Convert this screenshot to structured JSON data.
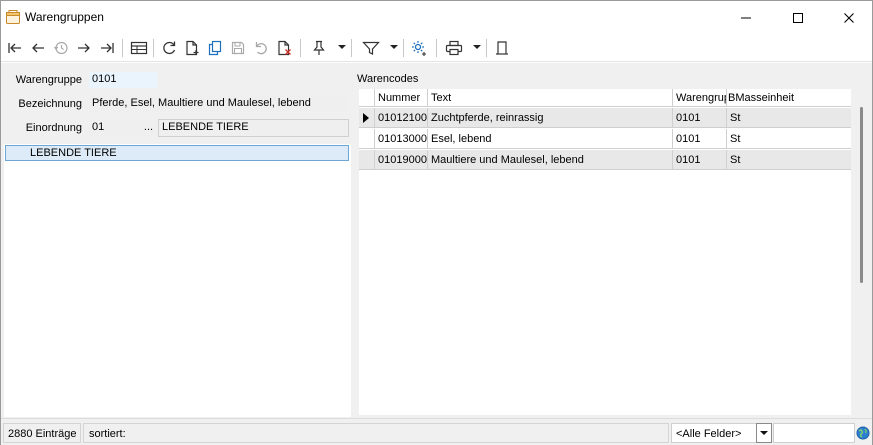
{
  "window": {
    "title": "Warengruppen"
  },
  "toolbar": {
    "items": [
      "first-record",
      "previous-record",
      "history",
      "next-record",
      "last-record",
      "table-view",
      "refresh",
      "new",
      "copy",
      "save",
      "undo",
      "delete",
      "pin",
      "filter",
      "settings",
      "print",
      "page"
    ]
  },
  "form": {
    "warengruppe_label": "Warengruppe",
    "warengruppe_value": "0101",
    "bezeichnung_label": "Bezeichnung",
    "bezeichnung_value": "Pferde, Esel, Maultiere und Maulesel, lebend",
    "einordnung_label": "Einordnung",
    "einordnung_value": "01",
    "einordnung_button": "...",
    "einordnung_text": "LEBENDE TIERE"
  },
  "tree": {
    "selected_item": "LEBENDE TIERE"
  },
  "warencodes": {
    "title": "Warencodes",
    "columns": [
      "Nummer",
      "Text",
      "Warengruppe",
      "BMasseinheit"
    ],
    "rows": [
      {
        "nummer": "01012100",
        "text": "Zuchtpferde, reinrassig",
        "warengruppe": "0101",
        "einheit": "St",
        "current": true
      },
      {
        "nummer": "01013000",
        "text": "Esel, lebend",
        "warengruppe": "0101",
        "einheit": "St",
        "current": false
      },
      {
        "nummer": "01019000",
        "text": "Maultiere und Maulesel, lebend",
        "warengruppe": "0101",
        "einheit": "St",
        "current": false
      }
    ]
  },
  "status": {
    "count": "2880 Einträge",
    "sort_label": "sortiert:",
    "field_select": "<Alle Felder>",
    "search_value": ""
  },
  "colors": {
    "accent": "#0078d4",
    "selection_bg": "#dcebf7",
    "selection_border": "#6ea6d6",
    "field_blue": "#eaf4fc"
  }
}
